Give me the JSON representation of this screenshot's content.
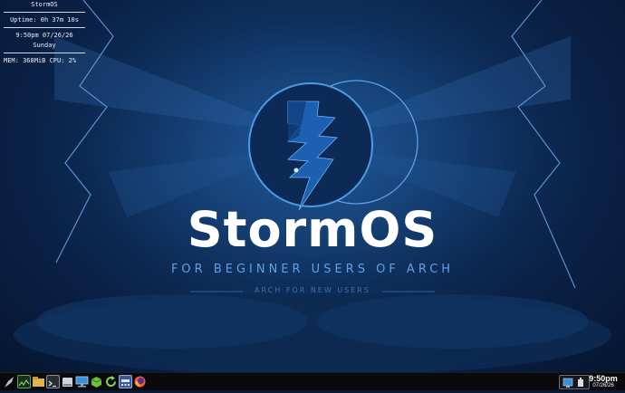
{
  "conky": {
    "title": "StormOS",
    "uptime": "Uptime: 0h 37m 10s",
    "time_date": "9:50pm  07/26/26",
    "weekday": "Sunday",
    "stats": "MEM: 368MiB  CPU: 2%"
  },
  "wallpaper": {
    "brand": "StormOS",
    "tagline": "FOR BEGINNER USERS OF ARCH",
    "subline": "ARCH FOR NEW USERS"
  },
  "taskbar": {
    "launchers": [
      "rocket-icon",
      "system-monitor-icon",
      "file-manager-icon",
      "terminal-icon",
      "drive-icon",
      "network-icon",
      "package-icon",
      "refresh-icon",
      "calculator-icon",
      "firefox-icon"
    ],
    "clock_time": "9:50pm",
    "clock_date": "07/26/26"
  },
  "colors": {
    "accent": "#4a9be8",
    "background": "#0a2146",
    "taskbar": "#0a0a0c"
  }
}
